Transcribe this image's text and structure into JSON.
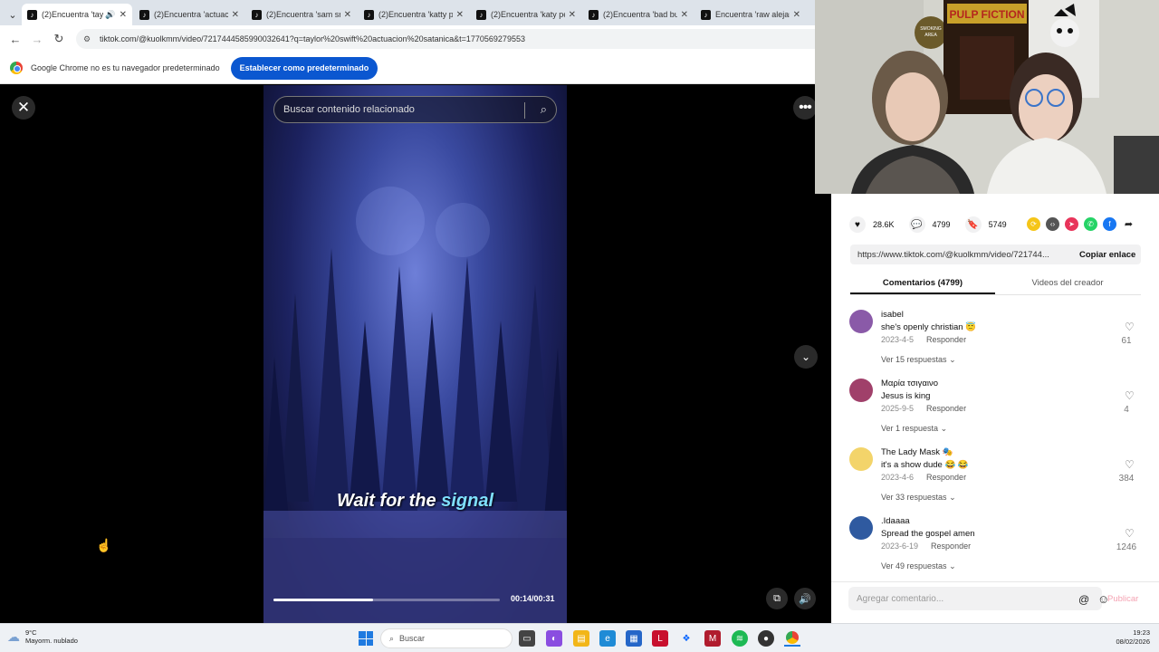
{
  "browser": {
    "tabs": [
      {
        "title": "(2)Encuentra 'tayl",
        "active": true,
        "audio": true
      },
      {
        "title": "(2)Encuentra 'actuaci",
        "active": false
      },
      {
        "title": "(2)Encuentra 'sam sm",
        "active": false
      },
      {
        "title": "(2)Encuentra 'katty p",
        "active": false
      },
      {
        "title": "(2)Encuentra 'katy pe",
        "active": false
      },
      {
        "title": "(2)Encuentra 'bad bu",
        "active": false
      },
      {
        "title": "Encuentra 'raw alejan",
        "active": false
      }
    ],
    "url": "tiktok.com/@kuolkmm/video/7217444585990032641?q=taylor%20swift%20actuacion%20satanica&t=1770569279553",
    "infobar_text": "Google Chrome no es tu navegador predeterminado",
    "infobar_button": "Establecer como predeterminado"
  },
  "video": {
    "search_placeholder": "Buscar contenido relacionado",
    "caption_part1": "Wait for the",
    "caption_part2": "signal",
    "time": "00:14/00:31",
    "progress": 0.44
  },
  "panel": {
    "likes": "28.6K",
    "comments_count": "4799",
    "saves": "5749",
    "link": "https://www.tiktok.com/@kuolkmm/video/721744...",
    "copy_link": "Copiar enlace",
    "tab_comments": "Comentarios (4799)",
    "tab_creator": "Videos del creador",
    "comments": [
      {
        "user": "isabel",
        "text": "she's openly christian 😇",
        "date": "2023-4-5",
        "reply": "Responder",
        "replies": "Ver 15 respuestas",
        "likes": "61",
        "avatar_color": "#8a5aa8"
      },
      {
        "user": "Μαρία τσιγαινο",
        "text": "Jesus is king",
        "date": "2025-9-5",
        "reply": "Responder",
        "replies": "Ver 1 respuesta",
        "likes": "4",
        "avatar_color": "#a0406a"
      },
      {
        "user": "The Lady Mask 🎭",
        "text": "it's a show dude 😂 😂",
        "date": "2023-4-6",
        "reply": "Responder",
        "replies": "Ver 33 respuestas",
        "likes": "384",
        "avatar_color": "#f3d46a"
      },
      {
        "user": ".Idaaaa",
        "text": "Spread the gospel amen",
        "date": "2023-6-19",
        "reply": "Responder",
        "replies": "Ver 49 respuestas",
        "likes": "1246",
        "avatar_color": "#2f5aa0"
      }
    ],
    "comment_placeholder": "Agregar comentario...",
    "publish": "Publicar"
  },
  "taskbar": {
    "temp": "9°C",
    "weather": "Mayorm. nublado",
    "search": "Buscar",
    "time": "19:23",
    "date": "08/02/2026"
  },
  "poster": {
    "title": "PULP FICTION"
  },
  "sign": {
    "line1": "SMOKING",
    "line2": "AREA"
  }
}
